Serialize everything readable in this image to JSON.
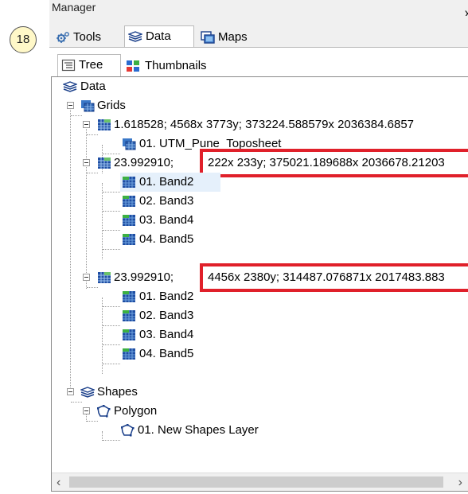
{
  "window": {
    "title": "Manager",
    "close": "x"
  },
  "badge": "18",
  "tabs": [
    {
      "label": "Tools",
      "icon": "gear-icon"
    },
    {
      "label": "Data",
      "icon": "data-stack-icon"
    },
    {
      "label": "Maps",
      "icon": "maps-icon"
    }
  ],
  "view_tabs": [
    {
      "label": "Tree",
      "icon": "tree-view-icon"
    },
    {
      "label": "Thumbnails",
      "icon": "thumbnails-icon"
    }
  ],
  "tree": {
    "root": "Data",
    "grids_label": "Grids",
    "grid_group_1": {
      "label": "1.618528; 4568x 3773y; 373224.588579x 2036384.6857",
      "item": "01. UTM_Pune_Toposheet"
    },
    "grid_group_2": {
      "prefix": "23.992910;",
      "highlight": "222x 233y; 375021.189688x 2036678.21203",
      "items": [
        "01. Band2",
        "02. Band3",
        "03. Band4",
        "04. Band5"
      ]
    },
    "grid_group_3": {
      "prefix": "23.992910;",
      "highlight": "4456x 2380y; 314487.076871x 2017483.883",
      "items": [
        "01. Band2",
        "02. Band3",
        "03. Band4",
        "04. Band5"
      ]
    },
    "shapes_label": "Shapes",
    "polygon_label": "Polygon",
    "shape_item": "01. New Shapes Layer"
  },
  "scroll": {
    "left": "‹",
    "right": "›"
  },
  "colors": {
    "highlight_box": "#e0202a",
    "selection": "#e5f0fb"
  }
}
